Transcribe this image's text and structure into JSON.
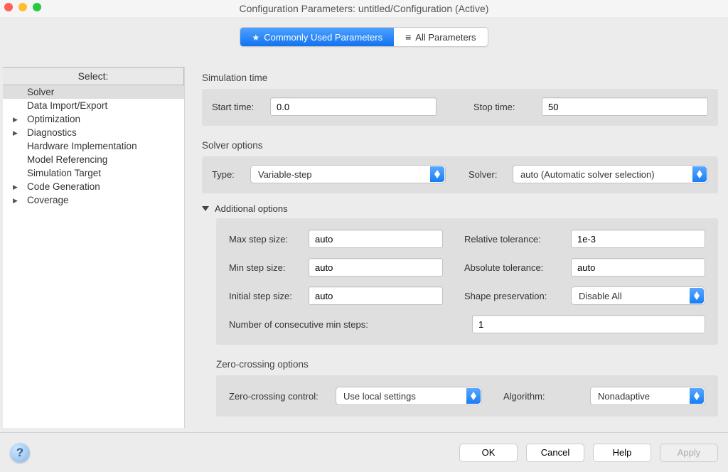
{
  "window": {
    "title": "Configuration Parameters: untitled/Configuration (Active)"
  },
  "tabs": {
    "commonly_used": "Commonly Used Parameters",
    "all": "All Parameters"
  },
  "tree": {
    "header": "Select:",
    "items": [
      {
        "label": "Solver",
        "expandable": false,
        "selected": true
      },
      {
        "label": "Data Import/Export",
        "expandable": false
      },
      {
        "label": "Optimization",
        "expandable": true
      },
      {
        "label": "Diagnostics",
        "expandable": true
      },
      {
        "label": "Hardware Implementation",
        "expandable": false
      },
      {
        "label": "Model Referencing",
        "expandable": false
      },
      {
        "label": "Simulation Target",
        "expandable": false
      },
      {
        "label": "Code Generation",
        "expandable": true
      },
      {
        "label": "Coverage",
        "expandable": true
      }
    ]
  },
  "simtime": {
    "header": "Simulation time",
    "start_label": "Start time:",
    "start_value": "0.0",
    "stop_label": "Stop time:",
    "stop_value": "50"
  },
  "solver": {
    "header": "Solver options",
    "type_label": "Type:",
    "type_value": "Variable-step",
    "solver_label": "Solver:",
    "solver_value": "auto (Automatic solver selection)"
  },
  "additional": {
    "header": "Additional options",
    "max_step_label": "Max step size:",
    "max_step_value": "auto",
    "rel_tol_label": "Relative tolerance:",
    "rel_tol_value": "1e-3",
    "min_step_label": "Min step size:",
    "min_step_value": "auto",
    "abs_tol_label": "Absolute tolerance:",
    "abs_tol_value": "auto",
    "init_step_label": "Initial step size:",
    "init_step_value": "auto",
    "shape_label": "Shape preservation:",
    "shape_value": "Disable All",
    "consec_label": "Number of consecutive min steps:",
    "consec_value": "1"
  },
  "zerocrossing": {
    "header": "Zero-crossing options",
    "control_label": "Zero-crossing control:",
    "control_value": "Use local settings",
    "algorithm_label": "Algorithm:",
    "algorithm_value": "Nonadaptive"
  },
  "footer": {
    "ok": "OK",
    "cancel": "Cancel",
    "help": "Help",
    "apply": "Apply"
  }
}
